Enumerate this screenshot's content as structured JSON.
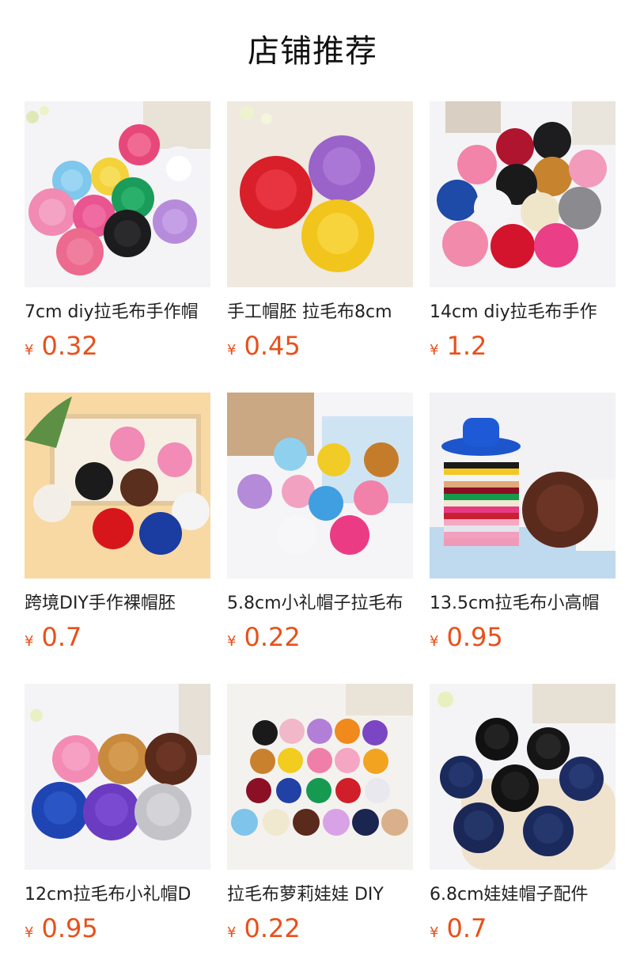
{
  "section": {
    "title": "店铺推荐"
  },
  "currency_symbol": "¥",
  "colors": {
    "price": "#e8501b",
    "title": "#111111",
    "name": "#222222"
  },
  "products": [
    {
      "name": "7cm diy拉毛布手作帽",
      "price": "0.32",
      "image": "assorted-color-mini-hats-photo"
    },
    {
      "name": "手工帽胚 拉毛布8cm",
      "price": "0.45",
      "image": "red-purple-yellow-hats-photo"
    },
    {
      "name": "14cm diy拉毛布手作",
      "price": "1.2",
      "image": "assorted-color-hats-photo"
    },
    {
      "name": "跨境DIY手作裸帽胚 ",
      "price": "0.7",
      "image": "cowboy-hats-patterned-photo"
    },
    {
      "name": "5.8cm小礼帽子拉毛布",
      "price": "0.22",
      "image": "pastel-mini-hats-photo"
    },
    {
      "name": "13.5cm拉毛布小高帽",
      "price": "0.95",
      "image": "stacked-top-hats-photo"
    },
    {
      "name": "12cm拉毛布小礼帽D",
      "price": "0.95",
      "image": "six-color-hats-photo"
    },
    {
      "name": "拉毛布萝莉娃娃 DIY",
      "price": "0.22",
      "image": "hat-grid-24-colors-photo"
    },
    {
      "name": "6.8cm娃娃帽子配件",
      "price": "0.7",
      "image": "black-navy-hats-photo"
    }
  ]
}
